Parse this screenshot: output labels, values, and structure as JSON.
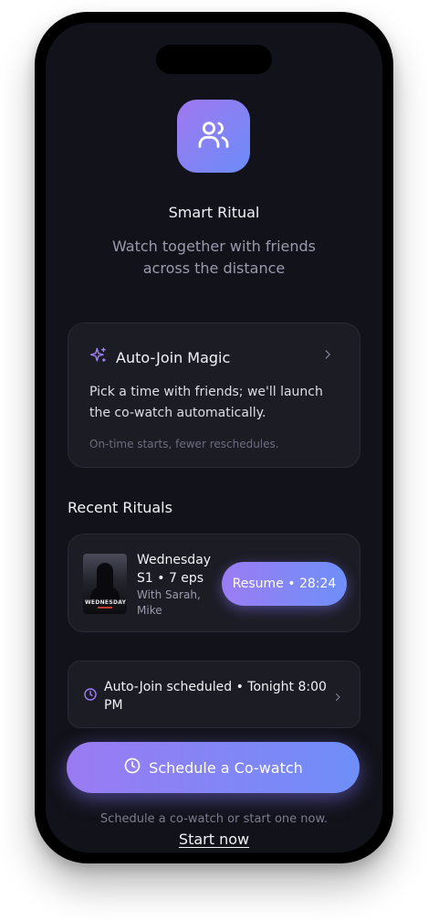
{
  "header": {
    "app_icon": "people-icon",
    "title": "Smart Ritual",
    "subtitle": "Watch together with friends across the distance"
  },
  "auto_join_card": {
    "icon": "sparkles-icon",
    "title": "Auto-Join Magic",
    "description": "Pick a time with friends; we'll launch the co-watch automatically.",
    "note": "On-time starts, fewer reschedules."
  },
  "recent": {
    "section_title": "Recent Rituals",
    "items": [
      {
        "poster_text": "WEDNESDAY",
        "title": "Wednesday",
        "episodes": "S1 • 7 eps",
        "participants": "With Sarah, Mike",
        "resume_label": "Resume • 28:24"
      }
    ]
  },
  "scheduled": {
    "icon": "clock-icon",
    "text": "Auto-Join scheduled • Tonight 8:00 PM"
  },
  "cta": {
    "icon": "clock-icon",
    "label": "Schedule a Co-watch"
  },
  "footer": {
    "text": "Schedule a co-watch or start one now.",
    "link": "Start now"
  },
  "colors": {
    "background": "#12121a",
    "card": "#1c1c25",
    "accent_start": "#9b7cf4",
    "accent_end": "#6e8ff8"
  }
}
